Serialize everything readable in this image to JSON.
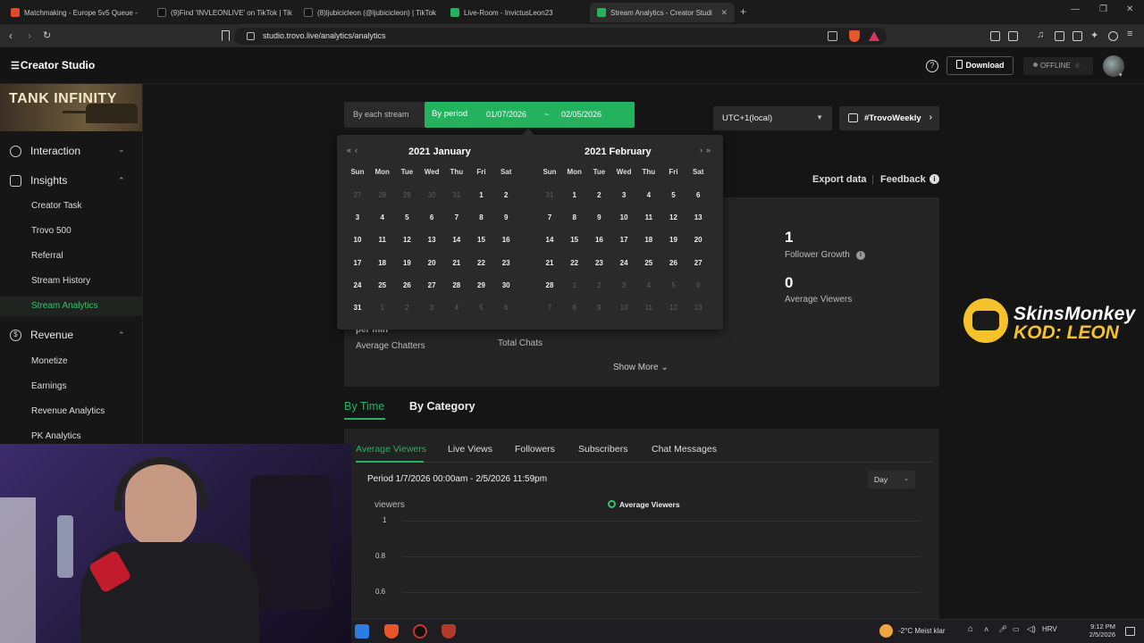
{
  "browser": {
    "tabs": [
      {
        "label": "Matchmaking - Europe 5v5 Queue -",
        "color": "#e04a2a"
      },
      {
        "label": "(9)Find 'INVLEONLIVE' on TikTok | Tik",
        "color": "#111111"
      },
      {
        "label": "(8)ljubicicleon (@ljubicicleon) | TikTok",
        "color": "#111111"
      },
      {
        "label": "Live-Room - InvictusLeon23",
        "color": "#23b35e"
      },
      {
        "label": "Stream Analytics - Creator Studi",
        "color": "#23b35e"
      }
    ],
    "url": "studio.trovo.live/analytics/analytics"
  },
  "header": {
    "logo": "Creator Studio",
    "download_label": "Download",
    "status_label": "OFFLINE"
  },
  "sidebar": {
    "banner": "TANK INFINITY",
    "sections": [
      {
        "label": "Interaction",
        "items": []
      },
      {
        "label": "Insights",
        "items": [
          "Creator Task",
          "Trovo 500",
          "Referral",
          "Stream History",
          "Stream Analytics"
        ]
      },
      {
        "label": "Revenue",
        "items": [
          "Monetize",
          "Earnings",
          "Revenue Analytics",
          "PK Analytics"
        ]
      }
    ],
    "active_item": "Stream Analytics"
  },
  "filter": {
    "by_each_stream": "By each stream",
    "by_period": "By period",
    "start_date": "01/07/2026",
    "separator": "~",
    "end_date": "02/05/2026",
    "timezone": "UTC+1(local)",
    "hashtag": "#TrovoWeekly"
  },
  "actions": {
    "export": "Export data",
    "feedback": "Feedback"
  },
  "calendar": {
    "left": {
      "title": "2021 January"
    },
    "right": {
      "title": "2021 February"
    },
    "weekdays": [
      "Sun",
      "Mon",
      "Tue",
      "Wed",
      "Thu",
      "Fri",
      "Sat"
    ],
    "left_weeks": [
      [
        [
          "27",
          1
        ],
        [
          "28",
          1
        ],
        [
          "29",
          1
        ],
        [
          "30",
          1
        ],
        [
          "31",
          1
        ],
        [
          "1",
          0
        ],
        [
          "2",
          0
        ]
      ],
      [
        [
          "3",
          0
        ],
        [
          "4",
          0
        ],
        [
          "5",
          0
        ],
        [
          "6",
          0
        ],
        [
          "7",
          0
        ],
        [
          "8",
          0
        ],
        [
          "9",
          0
        ]
      ],
      [
        [
          "10",
          0
        ],
        [
          "11",
          0
        ],
        [
          "12",
          0
        ],
        [
          "13",
          0
        ],
        [
          "14",
          0
        ],
        [
          "15",
          0
        ],
        [
          "16",
          0
        ]
      ],
      [
        [
          "17",
          0
        ],
        [
          "18",
          0
        ],
        [
          "19",
          0
        ],
        [
          "20",
          0
        ],
        [
          "21",
          0
        ],
        [
          "22",
          0
        ],
        [
          "23",
          0
        ]
      ],
      [
        [
          "24",
          0
        ],
        [
          "25",
          0
        ],
        [
          "26",
          0
        ],
        [
          "27",
          0
        ],
        [
          "28",
          0
        ],
        [
          "29",
          0
        ],
        [
          "30",
          0
        ]
      ],
      [
        [
          "31",
          0
        ],
        [
          "1",
          1
        ],
        [
          "2",
          1
        ],
        [
          "3",
          1
        ],
        [
          "4",
          1
        ],
        [
          "5",
          1
        ],
        [
          "6",
          1
        ]
      ]
    ],
    "right_weeks": [
      [
        [
          "31",
          1
        ],
        [
          "1",
          0
        ],
        [
          "2",
          0
        ],
        [
          "3",
          0
        ],
        [
          "4",
          0
        ],
        [
          "5",
          0
        ],
        [
          "6",
          0
        ]
      ],
      [
        [
          "7",
          0
        ],
        [
          "8",
          0
        ],
        [
          "9",
          0
        ],
        [
          "10",
          0
        ],
        [
          "11",
          0
        ],
        [
          "12",
          0
        ],
        [
          "13",
          0
        ]
      ],
      [
        [
          "14",
          0
        ],
        [
          "15",
          0
        ],
        [
          "16",
          0
        ],
        [
          "17",
          0
        ],
        [
          "18",
          0
        ],
        [
          "19",
          0
        ],
        [
          "20",
          0
        ]
      ],
      [
        [
          "21",
          0
        ],
        [
          "22",
          0
        ],
        [
          "23",
          0
        ],
        [
          "24",
          0
        ],
        [
          "25",
          0
        ],
        [
          "26",
          0
        ],
        [
          "27",
          0
        ]
      ],
      [
        [
          "28",
          0
        ],
        [
          "1",
          1
        ],
        [
          "2",
          1
        ],
        [
          "3",
          1
        ],
        [
          "4",
          1
        ],
        [
          "5",
          1
        ],
        [
          "6",
          1
        ]
      ],
      [
        [
          "7",
          1
        ],
        [
          "8",
          1
        ],
        [
          "9",
          1
        ],
        [
          "10",
          1
        ],
        [
          "11",
          1
        ],
        [
          "12",
          1
        ],
        [
          "13",
          1
        ]
      ]
    ]
  },
  "metrics": {
    "follower_growth": {
      "value": "1",
      "label": "Follower Growth"
    },
    "average_viewers": {
      "value": "0",
      "label": "Average Viewers"
    },
    "average_chatters": {
      "value": "per min",
      "label": "Average Chatters"
    },
    "total_chats": {
      "label": "Total Chats"
    },
    "show_more": "Show More"
  },
  "view_tabs": [
    "By Time",
    "By Category"
  ],
  "metric_tabs": [
    "Average Viewers",
    "Live Views",
    "Followers",
    "Subscribers",
    "Chat Messages"
  ],
  "chart": {
    "period": "Period 1/7/2026 00:00am - 2/5/2026 11:59pm",
    "granularity": "Day",
    "ylabel": "viewers",
    "legend": "Average Viewers",
    "yticks": [
      "1",
      "0.8",
      "0.6"
    ]
  },
  "promo": {
    "line1": "SkinsMonkey",
    "line2": "KOD: LEON"
  },
  "taskbar": {
    "weather": "-2°C  Meist klar",
    "lang": "HRV",
    "time": "9:12 PM",
    "date": "2/5/2026"
  }
}
